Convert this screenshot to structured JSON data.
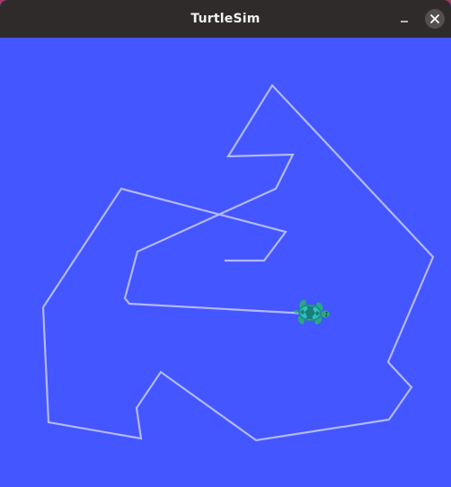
{
  "window": {
    "title": "TurtleSim"
  },
  "titlebar": {
    "minimize_icon": "minimize-icon",
    "close_icon": "close-icon"
  },
  "canvas": {
    "background_color": "#4356ff",
    "pen_color": "#b3b8ff",
    "turtle_icon": "turtle-icon"
  }
}
